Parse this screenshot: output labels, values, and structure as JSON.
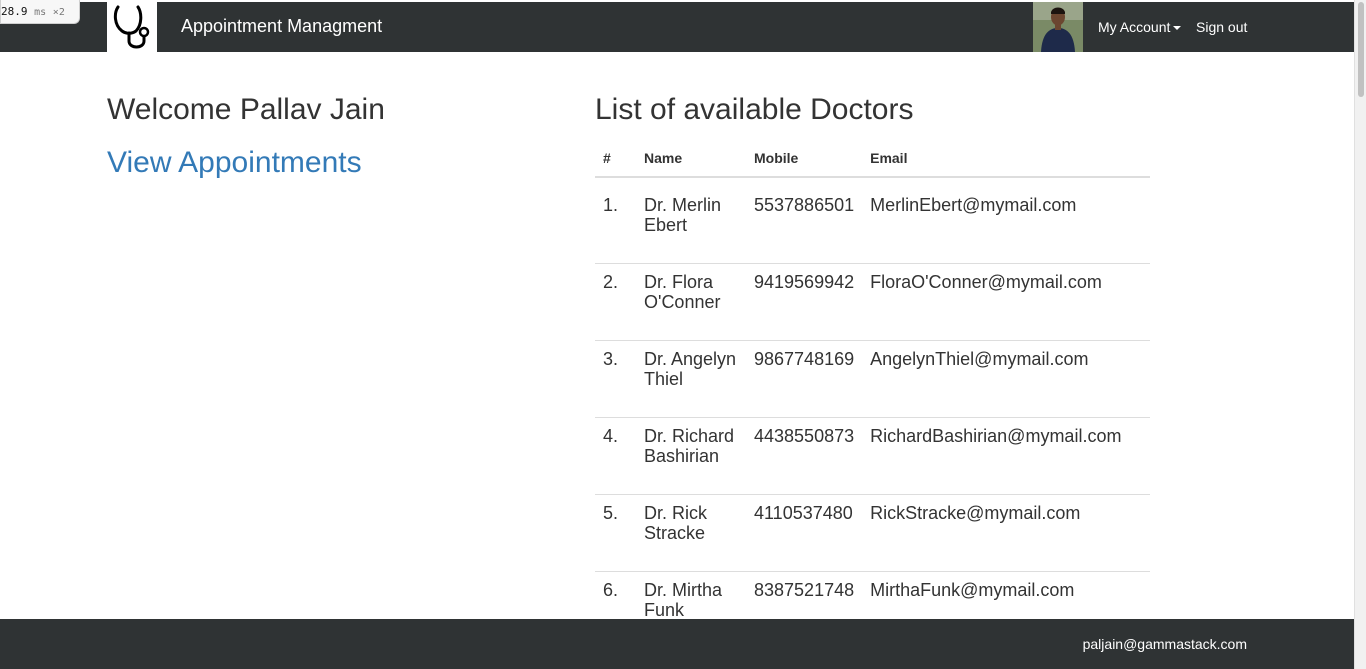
{
  "perf": {
    "value": "28.9",
    "unit": "ms",
    "multiplier": "×2"
  },
  "navbar": {
    "brand": "Appointment Managment",
    "logo_icon": "stethoscope-icon",
    "my_account": "My Account",
    "sign_out": "Sign out"
  },
  "welcome": {
    "text": "Welcome Pallav Jain",
    "view_appointments": "View Appointments"
  },
  "doctors": {
    "title": "List of available Doctors",
    "headers": [
      "#",
      "Name",
      "Mobile",
      "Email"
    ],
    "rows": [
      {
        "num": "1.",
        "name": "Dr. Merlin Ebert",
        "mobile": "5537886501",
        "email": "MerlinEbert@mymail.com"
      },
      {
        "num": "2.",
        "name": "Dr. Flora O'Conner",
        "mobile": "9419569942",
        "email": "FloraO'Conner@mymail.com"
      },
      {
        "num": "3.",
        "name": "Dr. Angelyn Thiel",
        "mobile": "9867748169",
        "email": "AngelynThiel@mymail.com"
      },
      {
        "num": "4.",
        "name": "Dr. Richard Bashirian",
        "mobile": "4438550873",
        "email": "RichardBashirian@mymail.com"
      },
      {
        "num": "5.",
        "name": "Dr. Rick Stracke",
        "mobile": "4110537480",
        "email": "RickStracke@mymail.com"
      },
      {
        "num": "6.",
        "name": "Dr. Mirtha Funk",
        "mobile": "8387521748",
        "email": "MirthaFunk@mymail.com"
      }
    ]
  },
  "footer": {
    "email": "paljain@gammastack.com"
  },
  "colors": {
    "navbar": "#2f3334",
    "link": "#337ab7",
    "text": "#333333"
  }
}
